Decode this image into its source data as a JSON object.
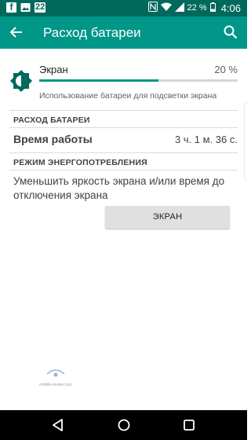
{
  "status_bar": {
    "notification_icons": [
      "facebook-icon",
      "gallery-icon",
      "calendar-icon"
    ],
    "calendar_day": "22",
    "battery_percent": "22 %",
    "time": "4:06",
    "color": "#00695c"
  },
  "app_bar": {
    "title": "Расход батареи",
    "back_icon": "arrow-back-icon",
    "search_icon": "search-icon",
    "color": "#009688"
  },
  "usage_item": {
    "title": "Экран",
    "percent_text": "20 %",
    "progress_fraction": 0.6,
    "description": "Использование батареи для подсветки экрана",
    "icon": "brightness-icon"
  },
  "battery_section": {
    "header": "РАСХОД БАТАРЕИ",
    "runtime_label": "Время работы",
    "runtime_value": "3 ч. 1 м. 36 с."
  },
  "power_section": {
    "header": "РЕЖИМ ЭНЕРГОПОТРЕБЛЕНИЯ",
    "description": "Уменьшить яркость экрана и/или время до отключения экрана",
    "button_label": "ЭКРАН"
  },
  "watermark": {
    "text": "mobile-review.com"
  },
  "nav_bar": {
    "icons": [
      "back-triangle-icon",
      "home-circle-icon",
      "recents-square-icon"
    ]
  }
}
